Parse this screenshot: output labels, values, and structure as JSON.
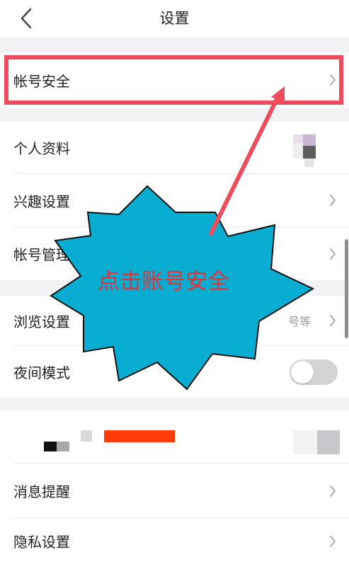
{
  "header": {
    "title": "设置",
    "back_icon": "chevron-left-icon"
  },
  "rows": {
    "account_security": "帐号安全",
    "profile": "个人资料",
    "interests": "兴趣设置",
    "account_manage": "帐号管理",
    "browse": "浏览设置",
    "browse_hint": "号等",
    "night_mode": "夜间模式",
    "notifications": "消息提醒",
    "privacy": "隐私设置"
  },
  "night_mode_on": false,
  "annotation": {
    "text": "点击账号安全"
  },
  "colors": {
    "highlight": "#ee4b5c",
    "burst_fill": "#0aadd2",
    "arrow": "#ee4b5c",
    "annotation_text": "#e63237",
    "redacted_bar": "#ff3b0a"
  }
}
